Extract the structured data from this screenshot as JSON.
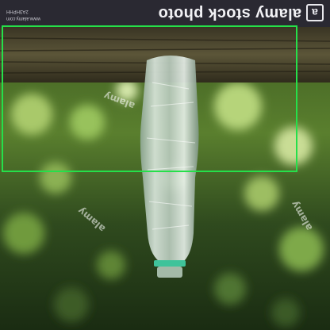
{
  "watermark": {
    "brand_text": "alamy stock photo",
    "brand_mark": "a",
    "meta_line1": "www.alamy.com",
    "meta_line2": "2A3HPHH",
    "repeat_text": "alamy"
  },
  "colors": {
    "banner": "#2a2932",
    "box": "#25e04a",
    "cap_ring": "#3fc39a"
  },
  "icons": [
    "alamy-logo-icon"
  ]
}
